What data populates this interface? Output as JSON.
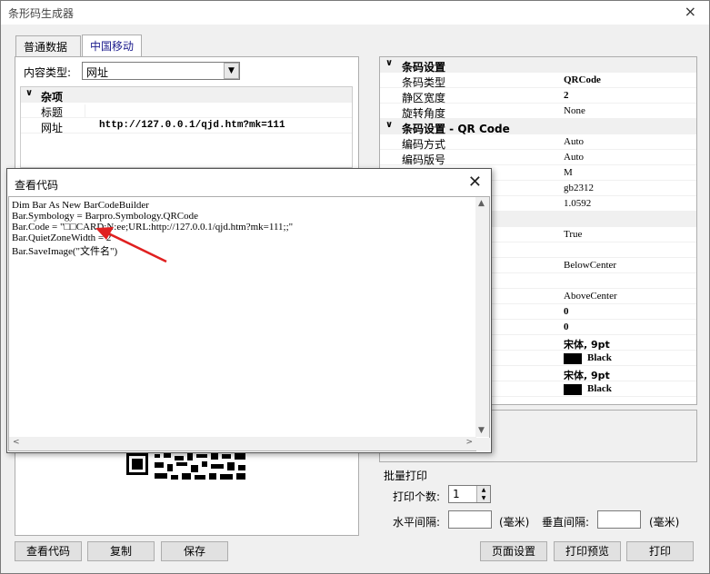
{
  "window": {
    "title": "条形码生成器",
    "close": "×"
  },
  "tabs": [
    {
      "label": "普通数据"
    },
    {
      "label": "中国移动"
    }
  ],
  "content_type": {
    "label": "内容类型:",
    "value": "网址"
  },
  "left_grid": {
    "category": "杂项",
    "rows": [
      {
        "name": "标题",
        "value": ""
      },
      {
        "name": "网址",
        "value": "http://127.0.0.1/qjd.htm?mk=111"
      }
    ]
  },
  "right_grid": {
    "cat1": "条码设置",
    "cat2": "条码设置 - QR Code",
    "rows1": [
      {
        "name": "条码类型",
        "value": "QRCode"
      },
      {
        "name": "静区宽度",
        "value": "2"
      },
      {
        "name": "旋转角度",
        "value": "None"
      }
    ],
    "rows2": [
      {
        "name": "编码方式",
        "value": "Auto"
      },
      {
        "name": "编码版号",
        "value": "Auto"
      },
      {
        "name": "",
        "value": "M"
      },
      {
        "name": "",
        "value": "gb2312"
      },
      {
        "name": "",
        "value": "1.0592"
      }
    ],
    "rows3": [
      {
        "name": "",
        "value": "True"
      },
      {
        "name": "",
        "value": ""
      },
      {
        "name": "",
        "value": "BelowCenter"
      },
      {
        "name": "",
        "value": ""
      },
      {
        "name": "",
        "value": "AboveCenter"
      },
      {
        "name": "",
        "value": "0"
      },
      {
        "name": "",
        "value": "0"
      },
      {
        "name": "",
        "value": "宋体, 9pt"
      },
      {
        "name": "",
        "value": "Black"
      },
      {
        "name": "",
        "value": "宋体, 9pt"
      },
      {
        "name": "",
        "value": "Black"
      }
    ],
    "color_swatch": "#000000"
  },
  "batch": {
    "title": "批量打印",
    "count_label": "打印个数:",
    "count_value": "1",
    "h_label": "水平间隔:",
    "v_label": "垂直间隔:",
    "unit": "(毫米)"
  },
  "buttons": {
    "view_code": "查看代码",
    "copy": "复制",
    "save": "保存",
    "page_setup": "页面设置",
    "print_preview": "打印预览",
    "print": "打印"
  },
  "dialog": {
    "title": "查看代码",
    "close": "✕",
    "code": [
      "Dim Bar As New BarCodeBuilder",
      "Bar.Symbology = Barpro.Symbology.QRCode",
      "Bar.Code = \"□□CARD:N:ee;URL:http://127.0.0.1/qjd.htm?mk=111;;\"",
      "Bar.QuietZoneWidth = 2",
      "Bar.SaveImage(\"文件名\")"
    ]
  },
  "colors": {
    "arrow": "#e02020",
    "tab_text": "#1a1a8c"
  }
}
